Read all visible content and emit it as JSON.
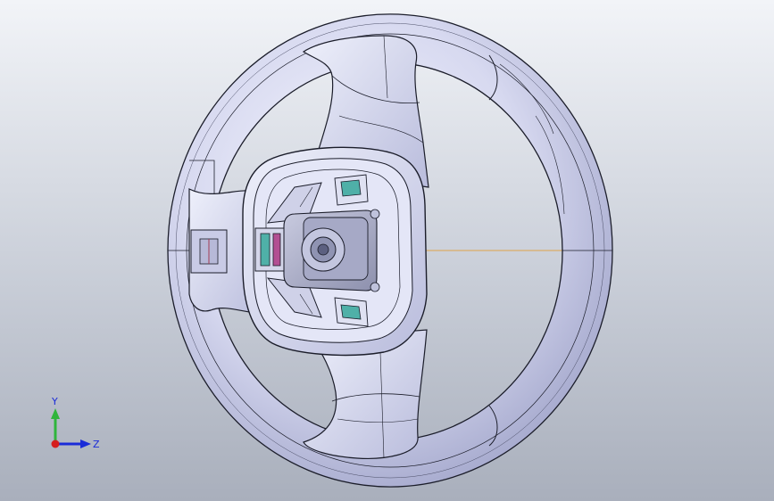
{
  "viewport": {
    "background_top": "#f2f4f8",
    "background_bottom": "#a9afbc",
    "model_fill": "#d9dcf2",
    "model_edge": "#1b1d2a",
    "ref_line_color": "#e0a24a"
  },
  "triad": {
    "y_label": "Y",
    "z_label": "Z",
    "y_color": "#2fb53c",
    "z_color": "#1a2bd8",
    "x_color": "#d51e1e"
  }
}
